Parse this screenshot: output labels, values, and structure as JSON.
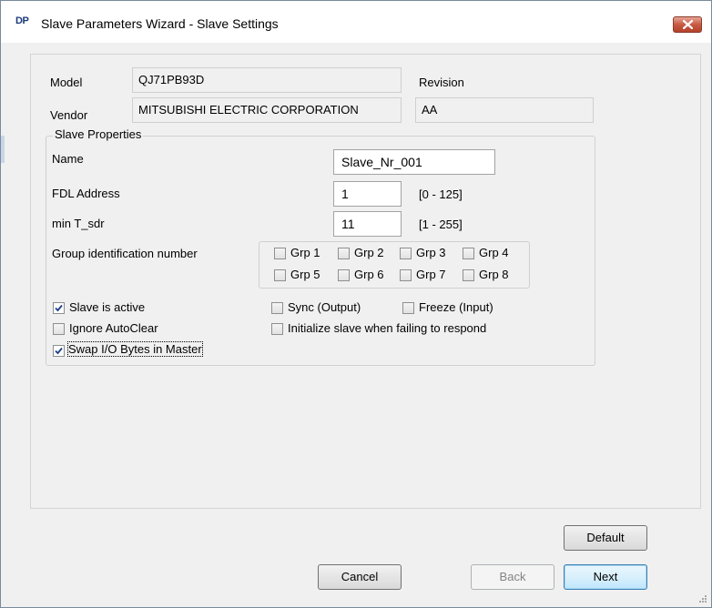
{
  "window": {
    "app_icon_text": "DP",
    "title": "Slave Parameters Wizard - Slave Settings"
  },
  "device": {
    "model_label": "Model",
    "model_value": "QJ71PB93D",
    "vendor_label": "Vendor",
    "vendor_value": "MITSUBISHI ELECTRIC CORPORATION",
    "revision_label": "Revision",
    "revision_value": "AA"
  },
  "slave_properties": {
    "group_title": "Slave Properties",
    "name_label": "Name",
    "name_value": "Slave_Nr_001",
    "fdl_label": "FDL Address",
    "fdl_value": "1",
    "fdl_range": "[0 - 125]",
    "tsdr_label": "min T_sdr",
    "tsdr_value": "11",
    "tsdr_range": "[1 - 255]",
    "group_id_label": "Group identification number",
    "groups": [
      {
        "label": "Grp 1",
        "checked": false
      },
      {
        "label": "Grp 2",
        "checked": false
      },
      {
        "label": "Grp 3",
        "checked": false
      },
      {
        "label": "Grp 4",
        "checked": false
      },
      {
        "label": "Grp 5",
        "checked": false
      },
      {
        "label": "Grp 6",
        "checked": false
      },
      {
        "label": "Grp 7",
        "checked": false
      },
      {
        "label": "Grp 8",
        "checked": false
      }
    ],
    "options": {
      "slave_active": {
        "label": "Slave is active",
        "checked": true
      },
      "ignore_autoclear": {
        "label": "Ignore AutoClear",
        "checked": false
      },
      "swap_io": {
        "label": "Swap I/O Bytes in Master",
        "checked": true
      },
      "sync_output": {
        "label": "Sync (Output)",
        "checked": false
      },
      "freeze_input": {
        "label": "Freeze (Input)",
        "checked": false
      },
      "init_slave": {
        "label": "Initialize slave when failing to respond",
        "checked": false
      }
    }
  },
  "buttons": {
    "default": "Default",
    "cancel": "Cancel",
    "back": "Back",
    "next": "Next"
  }
}
